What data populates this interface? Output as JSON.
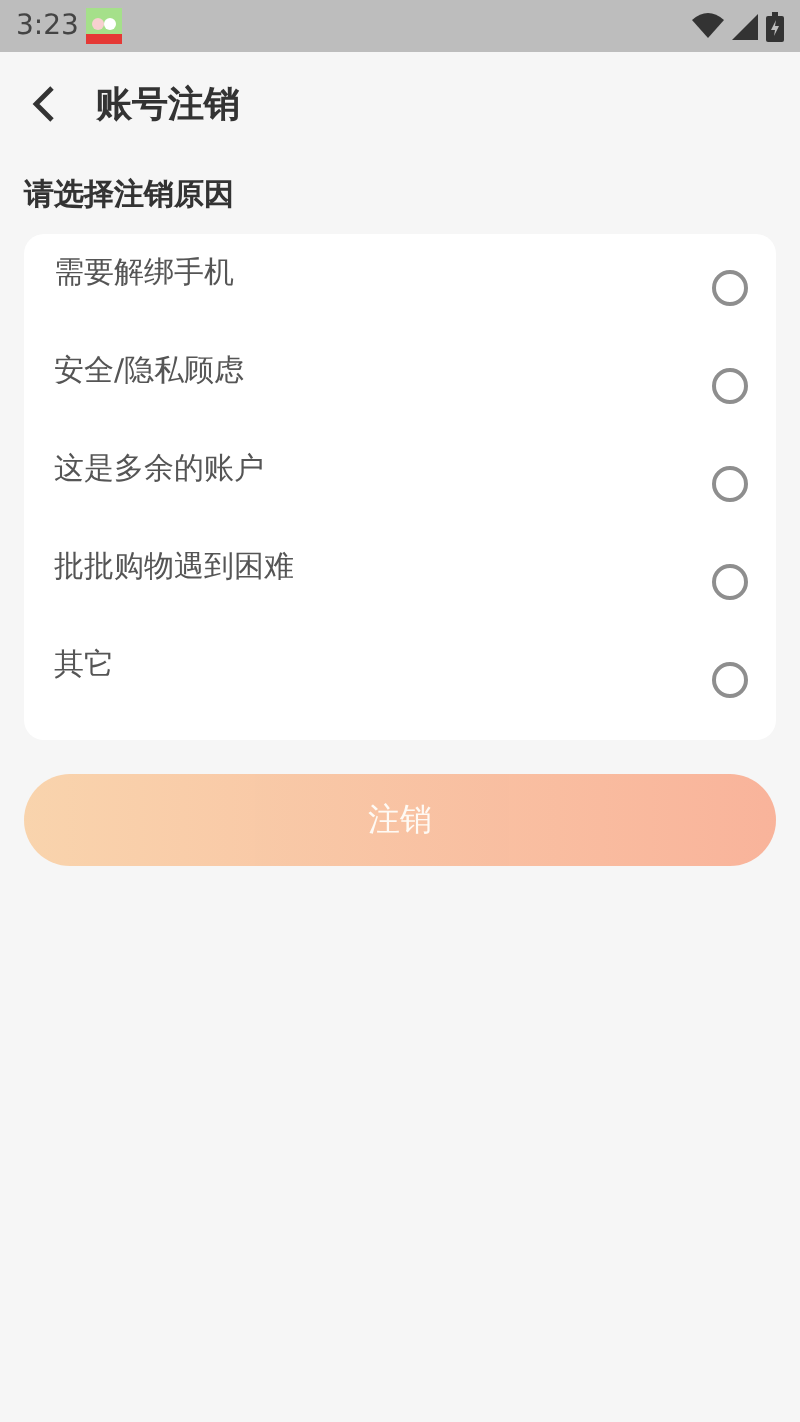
{
  "status_bar": {
    "time": "3:23"
  },
  "header": {
    "title": "账号注销"
  },
  "section_title": "请选择注销原因",
  "reasons": [
    {
      "label": "需要解绑手机",
      "selected": false
    },
    {
      "label": "安全/隐私顾虑",
      "selected": false
    },
    {
      "label": "这是多余的账户",
      "selected": false
    },
    {
      "label": "批批购物遇到困难",
      "selected": false
    },
    {
      "label": "其它",
      "selected": false
    }
  ],
  "submit_button": {
    "label": "注销",
    "disabled": true
  }
}
